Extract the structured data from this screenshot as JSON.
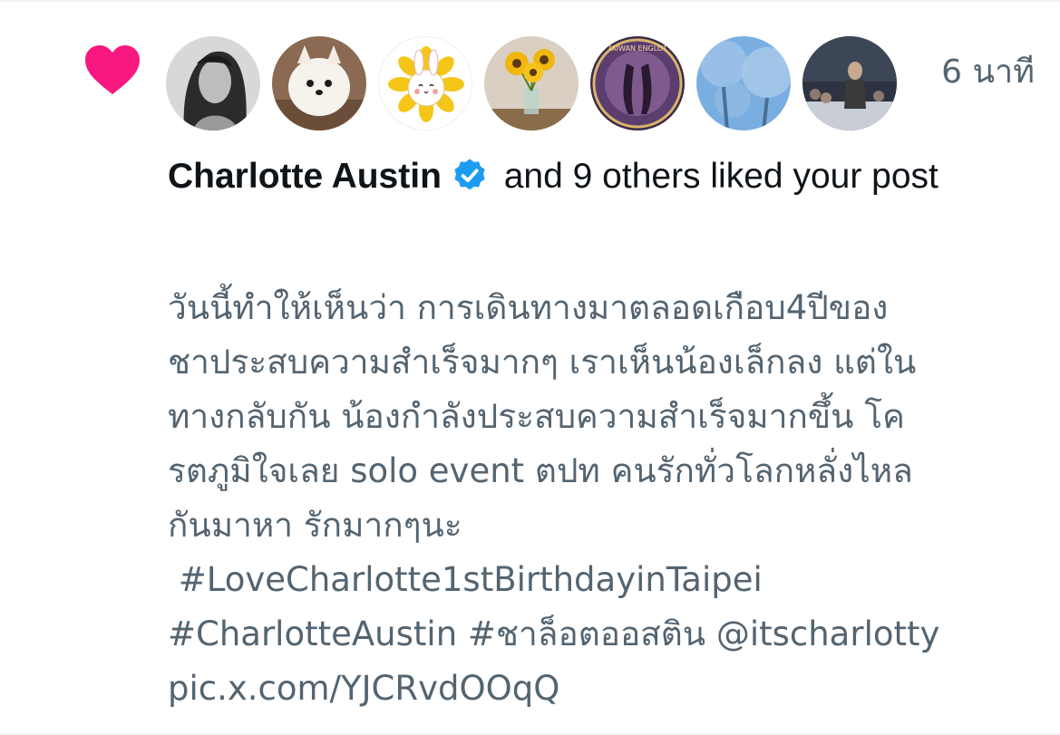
{
  "notification": {
    "timestamp": "6 นาที",
    "author_name": "Charlotte Austin",
    "liked_text": "and 9 others liked your post",
    "post_lines": [
      "วันนี้ทำให้เห็นว่า การเดินทางมาตลอดเกือบ4ปีของ",
      "ชาประสบความสำเร็จมากๆ เราเห็นน้องเล็กลง แต่ใน",
      "ทางกลับกัน น้องกำลังประสบความสำเร็จมากขึ้น โค",
      "รตภูมิใจเลย solo event ตปท คนรักทั่วโลกหลั่งไหล",
      "กันมาหา รักมากๆนะ",
      " #LoveCharlotte1stBirthdayinTaipei",
      "#CharlotteAustin #ชาล็อตออสติน @itscharlotty",
      "pic.x.com/YJCRvdOOqQ"
    ],
    "avatar_count": 7,
    "avatar_badge_text": "TAIWAN ENGLOT"
  },
  "icons": {
    "like": "heart-icon",
    "verified": "verified-badge-icon"
  },
  "colors": {
    "heart": "#f91880",
    "verified": "#1d9bf0",
    "secondary_text": "#536471",
    "primary_text": "#0f1419",
    "divider": "#eff3f4"
  }
}
